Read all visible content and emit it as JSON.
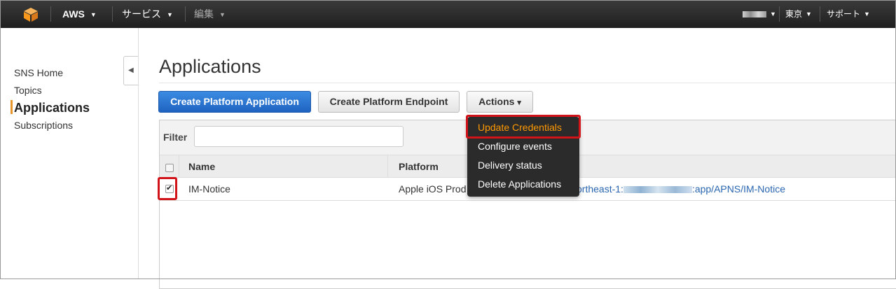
{
  "topbar": {
    "brand": "AWS",
    "services": "サービス",
    "edit": "編集",
    "region": "東京",
    "support": "サポート",
    "logo_color": "#f7981d"
  },
  "sidebar": {
    "items": [
      {
        "label": "SNS Home"
      },
      {
        "label": "Topics"
      },
      {
        "label": "Applications"
      },
      {
        "label": "Subscriptions"
      }
    ],
    "active_index": 2,
    "active_color": "#e8952b"
  },
  "main": {
    "title": "Applications",
    "buttons": {
      "create_app": "Create Platform Application",
      "create_endpoint": "Create Platform Endpoint",
      "actions": "Actions",
      "actions_caret": "▾"
    },
    "filter": {
      "label": "Filter",
      "value": "",
      "placeholder": ""
    },
    "table": {
      "columns": [
        "Name",
        "Platform"
      ],
      "rows": [
        {
          "checked": true,
          "name": "IM-Notice",
          "platform": "Apple iOS Prod",
          "arn_prefix": "ortheast-1:",
          "arn_suffix": ":app/APNS/IM-Notice"
        }
      ]
    },
    "actions_menu": {
      "items": [
        {
          "label": "Update Credentials"
        },
        {
          "label": "Configure events"
        },
        {
          "label": "Delivery status"
        },
        {
          "label": "Delete Applications"
        }
      ],
      "highlighted_index": 0
    }
  },
  "colors": {
    "primary_button": "#2062bf",
    "highlight_border": "#d0141a",
    "menu_active_text": "#ff9900",
    "link": "#2a66b0"
  }
}
